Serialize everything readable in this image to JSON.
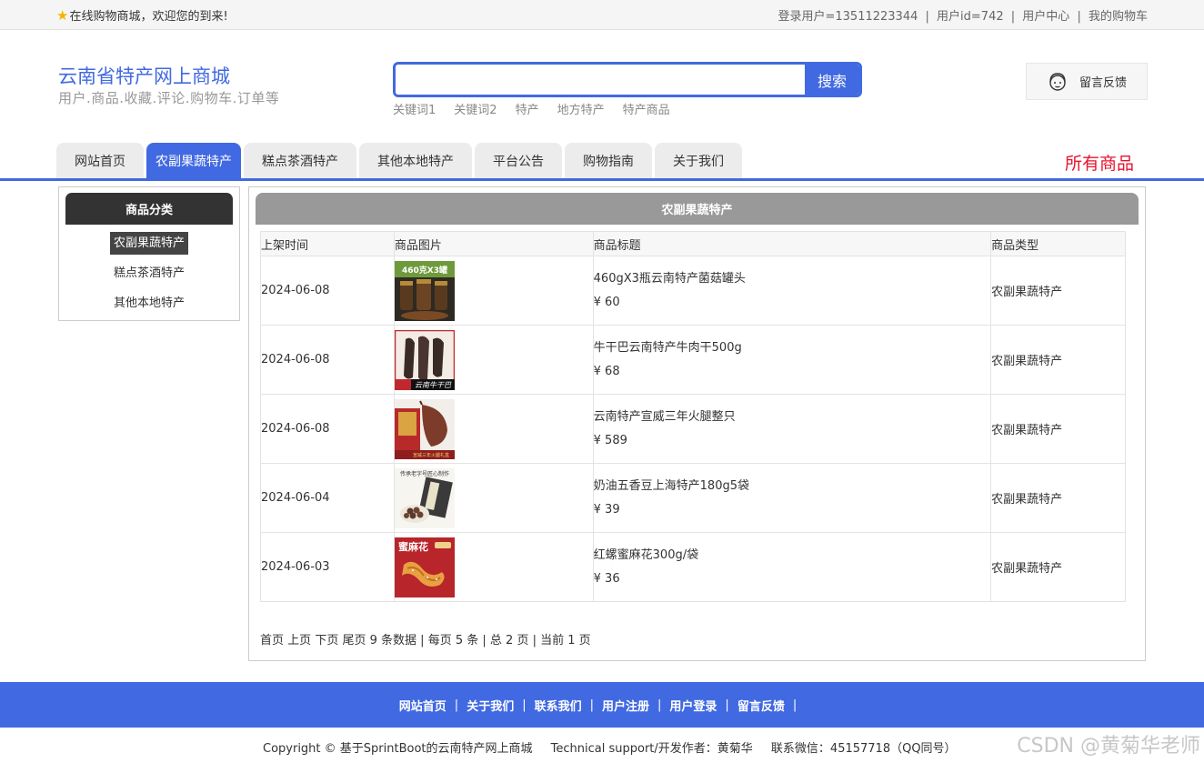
{
  "topbar": {
    "welcome": "在线购物商城，欢迎您的到来!",
    "login_user": "登录用户=13511223344",
    "user_id": "用户id=742",
    "user_center": "用户中心",
    "my_cart": "我的购物车",
    "sep": "|"
  },
  "header": {
    "site_title": "云南省特产网上商城",
    "site_subtitle": "用户.商品.收藏.评论.购物车.订单等",
    "search_placeholder": "",
    "search_button": "搜索",
    "hotwords": [
      "关键词1",
      "关键词2",
      "特产",
      "地方特产",
      "特产商品"
    ],
    "feedback": "留言反馈"
  },
  "nav": {
    "tabs": [
      "网站首页",
      "农副果蔬特产",
      "糕点茶酒特产",
      "其他本地特产",
      "平台公告",
      "购物指南",
      "关于我们"
    ],
    "all_goods": "所有商品"
  },
  "sidebar": {
    "title": "商品分类",
    "items": [
      "农副果蔬特产",
      "糕点茶酒特产",
      "其他本地特产"
    ]
  },
  "main": {
    "title": "农副果蔬特产",
    "columns": [
      "上架时间",
      "商品图片",
      "商品标题",
      "商品类型"
    ],
    "rows": [
      {
        "date": "2024-06-08",
        "title": "460gX3瓶云南特产菌菇罐头",
        "price": "¥ 60",
        "type": "农副果蔬特产",
        "img_text": "460克X3罐"
      },
      {
        "date": "2024-06-08",
        "title": "牛干巴云南特产牛肉干500g",
        "price": "¥ 68",
        "type": "农副果蔬特产",
        "img_text": "云南牛干巴"
      },
      {
        "date": "2024-06-08",
        "title": "云南特产宣威三年火腿整只",
        "price": "¥ 589",
        "type": "农副果蔬特产",
        "img_text": "宣威三年火腿礼盒"
      },
      {
        "date": "2024-06-04",
        "title": "奶油五香豆上海特产180g5袋",
        "price": "¥ 39",
        "type": "农副果蔬特产",
        "img_text": "传承老字号匠心制作"
      },
      {
        "date": "2024-06-03",
        "title": "红螺蜜麻花300g/袋",
        "price": "¥ 36",
        "type": "农副果蔬特产",
        "img_text": "蜜麻花"
      }
    ],
    "pager": {
      "first": "首页",
      "prev": "上页",
      "next": "下页",
      "last": "尾页",
      "total": "9 条数据",
      "per_page": "每页 5 条",
      "pages": "总 2 页",
      "current": "当前 1 页"
    }
  },
  "footer": {
    "links": [
      "网站首页",
      "关于我们",
      "联系我们",
      "用户注册",
      "用户登录",
      "留言反馈"
    ],
    "copyright": "Copyright © 基于SprintBoot的云南特产网上商城",
    "support": "Technical support/开发作者：黄菊华",
    "contact": "联系微信：45157718（QQ同号）",
    "watermark": "CSDN @黄菊华老师"
  },
  "colors": {
    "primary": "#4169e1",
    "accent_red": "#e8132d",
    "dark_header": "#333333",
    "gray_header": "#999999"
  }
}
